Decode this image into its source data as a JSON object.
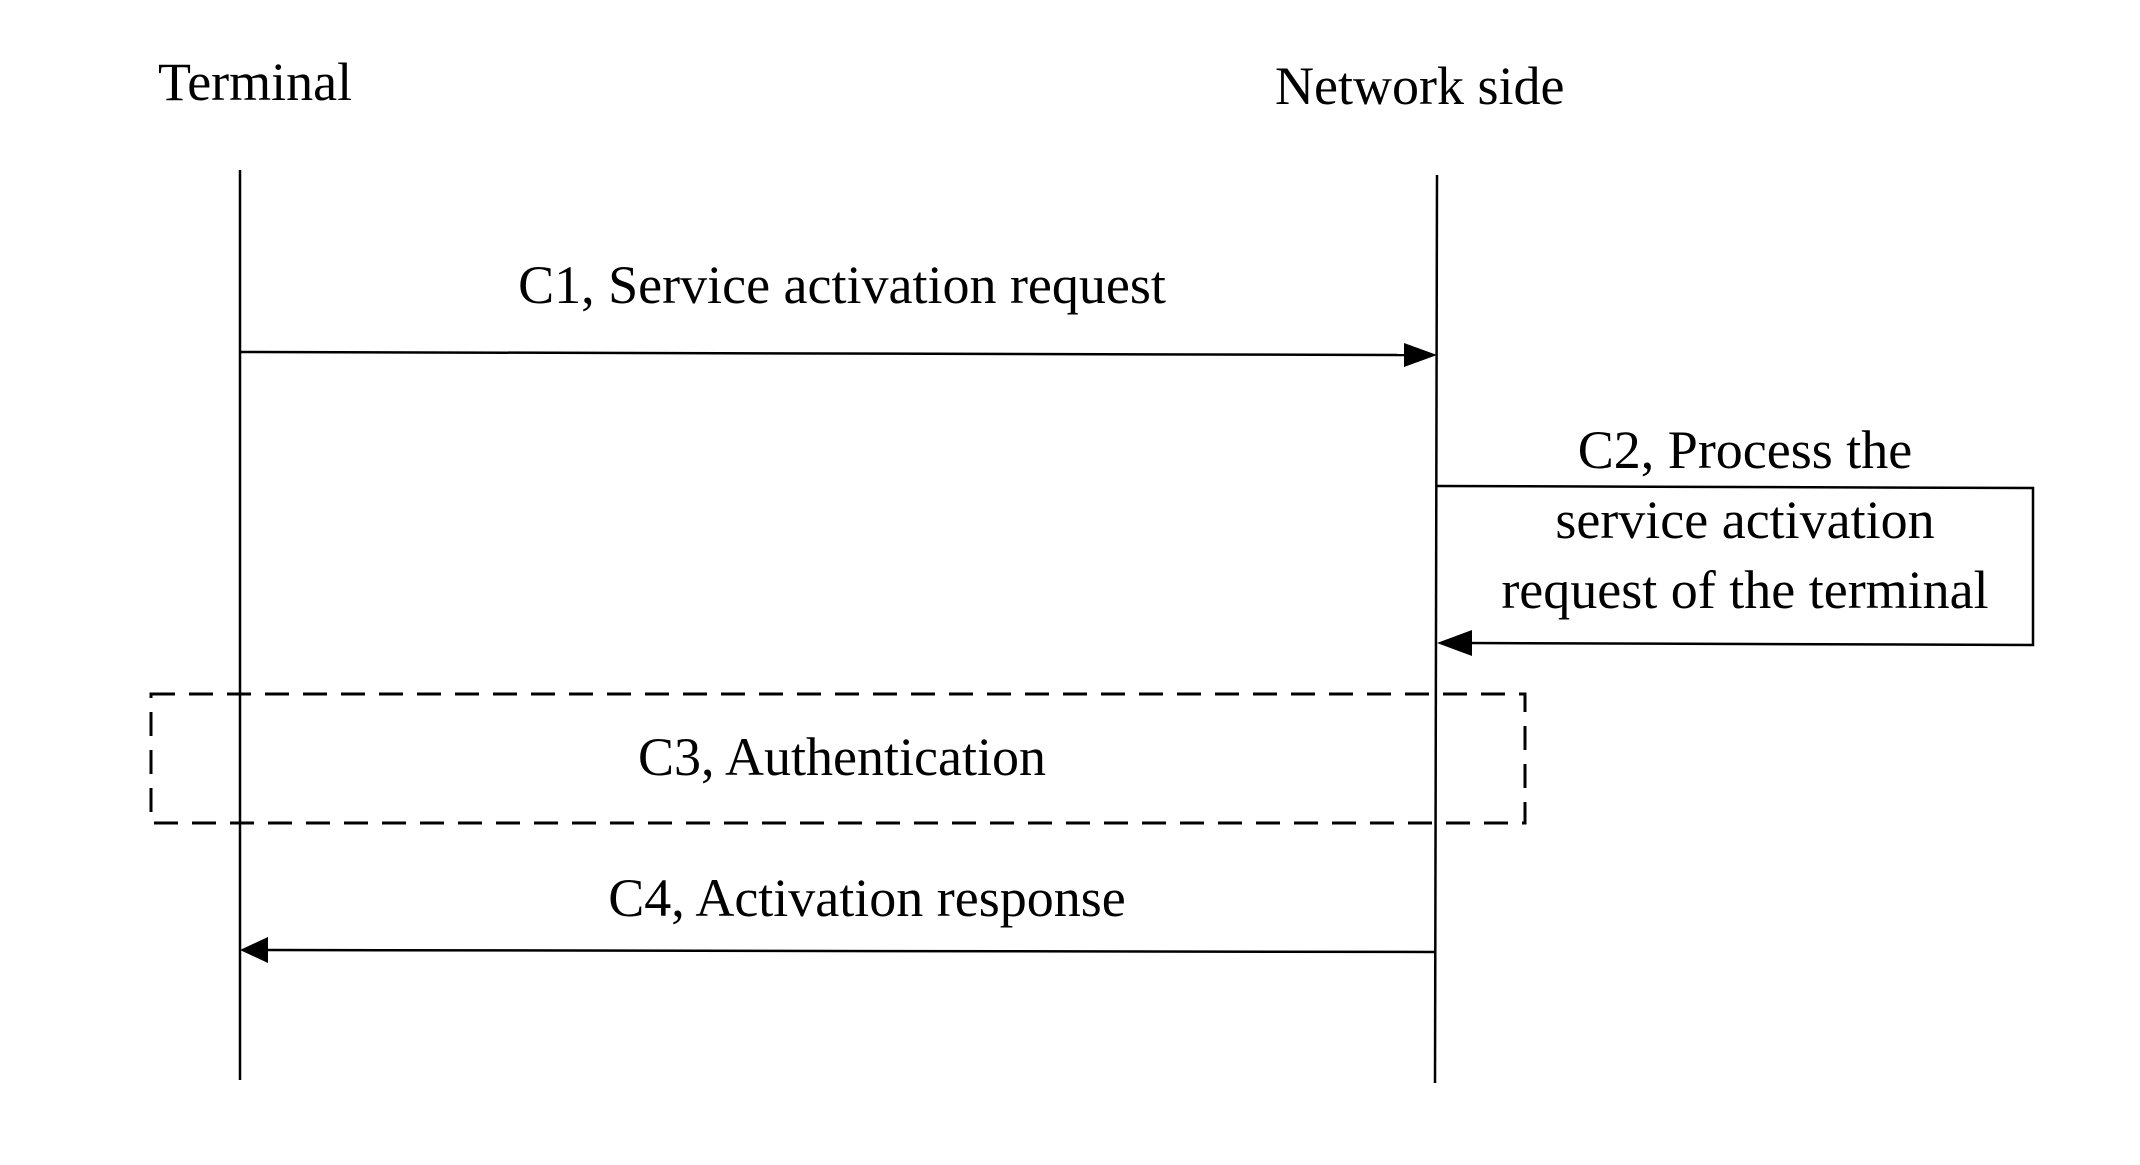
{
  "diagram": {
    "type": "sequence-diagram",
    "participants": [
      {
        "id": "terminal",
        "label": "Terminal"
      },
      {
        "id": "network",
        "label": "Network side"
      }
    ],
    "steps": [
      {
        "id": "C1",
        "kind": "message",
        "from": "terminal",
        "to": "network",
        "label": "C1, Service activation request"
      },
      {
        "id": "C2",
        "kind": "self-process",
        "on": "network",
        "label_lines": [
          "C2, Process the",
          "service activation",
          "request of the terminal"
        ]
      },
      {
        "id": "C3",
        "kind": "interaction-block",
        "between": [
          "terminal",
          "network"
        ],
        "style": "dashed",
        "label": "C3, Authentication"
      },
      {
        "id": "C4",
        "kind": "message",
        "from": "network",
        "to": "terminal",
        "label": "C4, Activation response"
      }
    ]
  }
}
